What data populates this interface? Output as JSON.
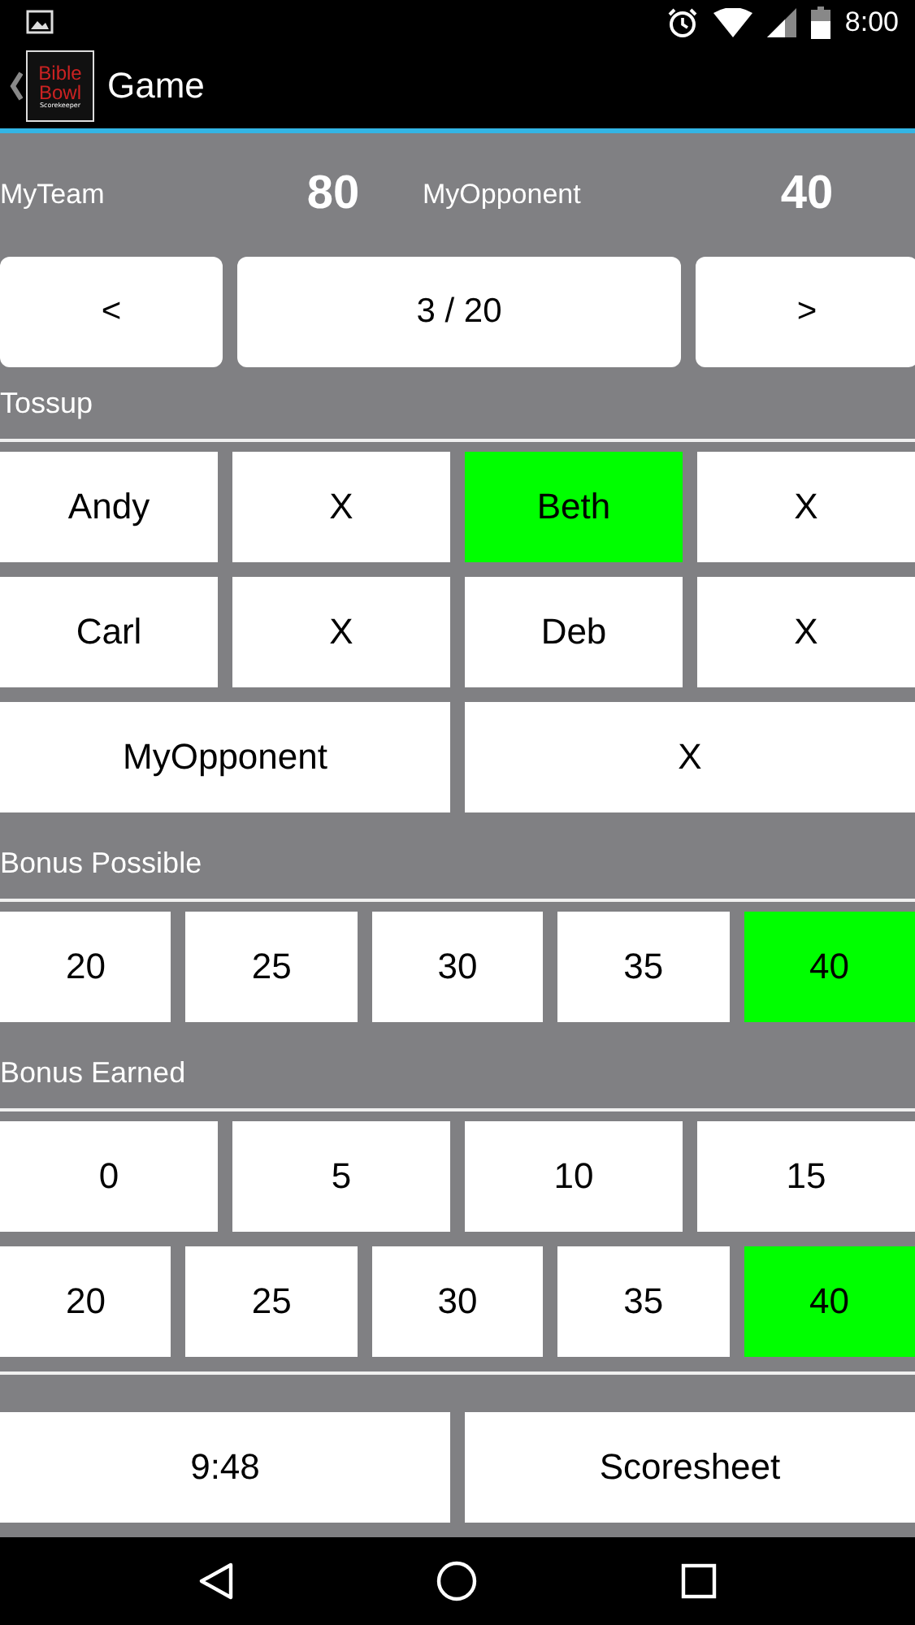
{
  "status_bar": {
    "time": "8:00"
  },
  "action_bar": {
    "logo_lines": [
      "Bible",
      "Bowl",
      "Scorekeeper"
    ],
    "title": "Game"
  },
  "scores": [
    {
      "team": "MyTeam",
      "score": "80"
    },
    {
      "team": "MyOpponent",
      "score": "40"
    }
  ],
  "navigation": {
    "previous": "<",
    "question": "3 / 20",
    "next": ">"
  },
  "tossup": {
    "label": "Tossup",
    "rows": [
      [
        {
          "label": "Andy",
          "selected": false
        },
        {
          "label": "X",
          "selected": false
        },
        {
          "label": "Beth",
          "selected": true
        },
        {
          "label": "X",
          "selected": false
        }
      ],
      [
        {
          "label": "Carl",
          "selected": false
        },
        {
          "label": "X",
          "selected": false
        },
        {
          "label": "Deb",
          "selected": false
        },
        {
          "label": "X",
          "selected": false
        }
      ],
      [
        {
          "label": "MyOpponent",
          "selected": false
        },
        {
          "label": "X",
          "selected": false
        }
      ]
    ]
  },
  "bonus_possible": {
    "label": "Bonus Possible",
    "rows": [
      [
        {
          "label": "20",
          "selected": false
        },
        {
          "label": "25",
          "selected": false
        },
        {
          "label": "30",
          "selected": false
        },
        {
          "label": "35",
          "selected": false
        },
        {
          "label": "40",
          "selected": true
        }
      ]
    ]
  },
  "bonus_earned": {
    "label": "Bonus Earned",
    "rows": [
      [
        {
          "label": "0",
          "selected": false
        },
        {
          "label": "5",
          "selected": false
        },
        {
          "label": "10",
          "selected": false
        },
        {
          "label": "15",
          "selected": false
        }
      ],
      [
        {
          "label": "20",
          "selected": false
        },
        {
          "label": "25",
          "selected": false
        },
        {
          "label": "30",
          "selected": false
        },
        {
          "label": "35",
          "selected": false
        },
        {
          "label": "40",
          "selected": true
        }
      ]
    ]
  },
  "footer": {
    "timer": "9:48",
    "scoresheet": "Scoresheet"
  }
}
